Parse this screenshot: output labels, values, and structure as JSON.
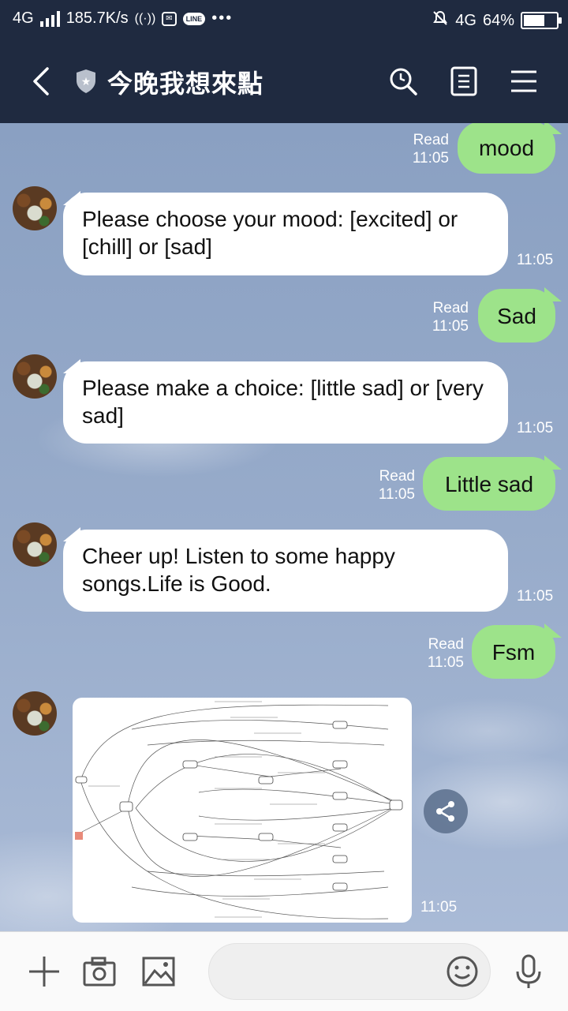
{
  "status": {
    "network": "4G",
    "speed": "185.7K/s",
    "network_right": "4G",
    "battery": "64%",
    "battery_level": 0.64
  },
  "header": {
    "back": "back-arrow-icon",
    "title": "今晚我想來點",
    "icons": [
      "search-icon",
      "notes-icon",
      "menu-icon"
    ]
  },
  "messages": [
    {
      "dir": "out",
      "text": "mood",
      "read": "Read",
      "time": "11:05"
    },
    {
      "dir": "in",
      "text": "Please choose your mood: [excited] or [chill] or [sad]",
      "time": "11:05"
    },
    {
      "dir": "out",
      "text": "Sad",
      "read": "Read",
      "time": "11:05"
    },
    {
      "dir": "in",
      "text": "Please make a choice: [little sad] or [very sad]",
      "time": "11:05"
    },
    {
      "dir": "out",
      "text": "Little sad",
      "read": "Read",
      "time": "11:05"
    },
    {
      "dir": "in",
      "text": "Cheer up! Listen to some happy songs.Life is Good.",
      "time": "11:05"
    },
    {
      "dir": "out",
      "text": "Fsm",
      "read": "Read",
      "time": "11:05"
    },
    {
      "dir": "in",
      "type": "image",
      "image": "fsm-state-diagram",
      "time": "11:05"
    }
  ],
  "composer": {
    "icons": [
      "plus-icon",
      "camera-icon",
      "image-icon",
      "emoji-icon",
      "microphone-icon"
    ],
    "placeholder": ""
  },
  "colors": {
    "header_bg": "#1f2a40",
    "outgoing_bubble": "#9de38a",
    "incoming_bubble": "#ffffff",
    "chat_bg": "#8ea3c4"
  }
}
